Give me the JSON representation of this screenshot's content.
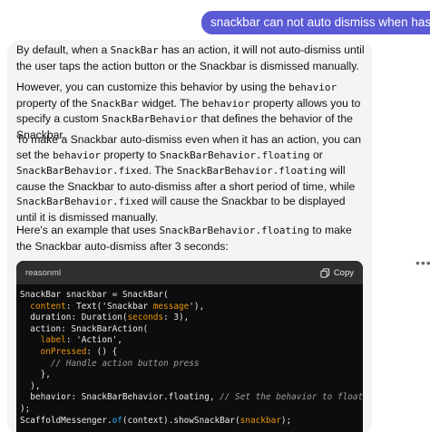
{
  "user_message": "snackbar can not auto dismiss when has actions",
  "paragraphs": [
    [
      {
        "t": "By default, when a "
      },
      {
        "c": "SnackBar"
      },
      {
        "t": " has an action, it will not auto-dismiss until the user taps the action button or the Snackbar is dismissed manually."
      }
    ],
    [
      {
        "t": "However, you can customize this behavior by using the "
      },
      {
        "c": "behavior"
      },
      {
        "t": " property of the "
      },
      {
        "c": "SnackBar"
      },
      {
        "t": " widget. The "
      },
      {
        "c": "behavior"
      },
      {
        "t": " property allows you to specify a custom "
      },
      {
        "c": "SnackBarBehavior"
      },
      {
        "t": " that defines the behavior of the Snackbar."
      }
    ],
    [
      {
        "t": "To make a Snackbar auto-dismiss even when it has an action, you can set the "
      },
      {
        "c": "behavior"
      },
      {
        "t": " property to "
      },
      {
        "c": "SnackBarBehavior.floating"
      },
      {
        "t": " or "
      },
      {
        "c": "SnackBarBehavior.fixed"
      },
      {
        "t": ". The "
      },
      {
        "c": "SnackBarBehavior.floating"
      },
      {
        "t": " will cause the Snackbar to auto-dismiss after a short period of time, while "
      },
      {
        "c": "SnackBarBehavior.fixed"
      },
      {
        "t": " will cause the Snackbar to be displayed until it is dismissed manually."
      }
    ],
    [
      {
        "t": "Here's an example that uses "
      },
      {
        "c": "SnackBarBehavior.floating"
      },
      {
        "t": " to make the Snackbar auto-dismiss after 3 seconds:"
      }
    ]
  ],
  "code": {
    "language": "reasonml",
    "copy_label": "Copy",
    "lines": [
      [
        {
          "t": "SnackBar snackbar = SnackBar("
        }
      ],
      [
        {
          "t": "  "
        },
        {
          "k": "content"
        },
        {
          "t": ": Text('Snackbar "
        },
        {
          "k": "message"
        },
        {
          "t": "'),"
        }
      ],
      [
        {
          "t": "  duration: Duration("
        },
        {
          "k": "seconds"
        },
        {
          "t": ": 3),"
        }
      ],
      [
        {
          "t": "  action: SnackBarAction("
        }
      ],
      [
        {
          "t": "    "
        },
        {
          "k": "label"
        },
        {
          "t": ": 'Action',"
        }
      ],
      [
        {
          "t": "    "
        },
        {
          "k": "onPressed"
        },
        {
          "t": ": () {"
        }
      ],
      [
        {
          "t": "      "
        },
        {
          "m": "// Handle action button press"
        }
      ],
      [
        {
          "t": "    },"
        }
      ],
      [
        {
          "t": "  ),"
        }
      ],
      [
        {
          "t": "  behavior: SnackBarBehavior.floating, "
        },
        {
          "m": "// Set the behavior to floating"
        }
      ],
      [
        {
          "t": ");"
        }
      ],
      [
        {
          "t": "ScaffoldMessenger."
        },
        {
          "f": "of"
        },
        {
          "t": "(context).showSnackBar("
        },
        {
          "k": "snackbar"
        },
        {
          "t": ");"
        }
      ]
    ]
  },
  "more_icon": "ellipsis-icon",
  "colors": {
    "user_bubble": "#5b5bd6",
    "assistant_bg": "#f4f4f4",
    "code_bg": "#0d0d0d",
    "code_header_bg": "#2f2f2f",
    "keyword": "#e9950c"
  }
}
